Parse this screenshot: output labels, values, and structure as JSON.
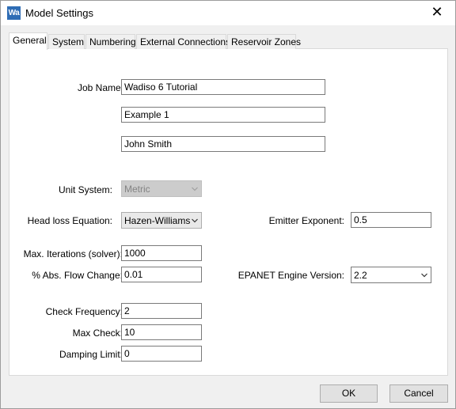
{
  "window": {
    "title": "Model Settings",
    "app_icon_text": "Wa"
  },
  "tabs": [
    {
      "label": "General",
      "active": true
    },
    {
      "label": "System"
    },
    {
      "label": "Numbering"
    },
    {
      "label": "External Connections"
    },
    {
      "label": "Reservoir Zones"
    }
  ],
  "job": {
    "label": "Job Name:",
    "line1": "Wadiso 6 Tutorial",
    "line2": "Example 1",
    "line3": "John Smith"
  },
  "unit_system": {
    "label": "Unit System:",
    "value": "Metric"
  },
  "head_loss": {
    "label": "Head loss Equation:",
    "value": "Hazen-Williams"
  },
  "emitter": {
    "label": "Emitter Exponent:",
    "value": "0.5"
  },
  "max_iterations": {
    "label": "Max. Iterations (solver):",
    "value": "1000"
  },
  "flow_change": {
    "label": "% Abs. Flow Change:",
    "value": "0.01"
  },
  "engine": {
    "label": "EPANET Engine Version:",
    "value": "2.2"
  },
  "check_frequency": {
    "label": "Check Frequency:",
    "value": "2"
  },
  "max_check": {
    "label": "Max Check:",
    "value": "10"
  },
  "damping": {
    "label": "Damping Limit:",
    "value": "0"
  },
  "buttons": {
    "ok": "OK",
    "cancel": "Cancel"
  },
  "icons": {
    "close": "close-icon",
    "app": "wadiso-app-icon",
    "chevron": "chevron-down-icon"
  }
}
